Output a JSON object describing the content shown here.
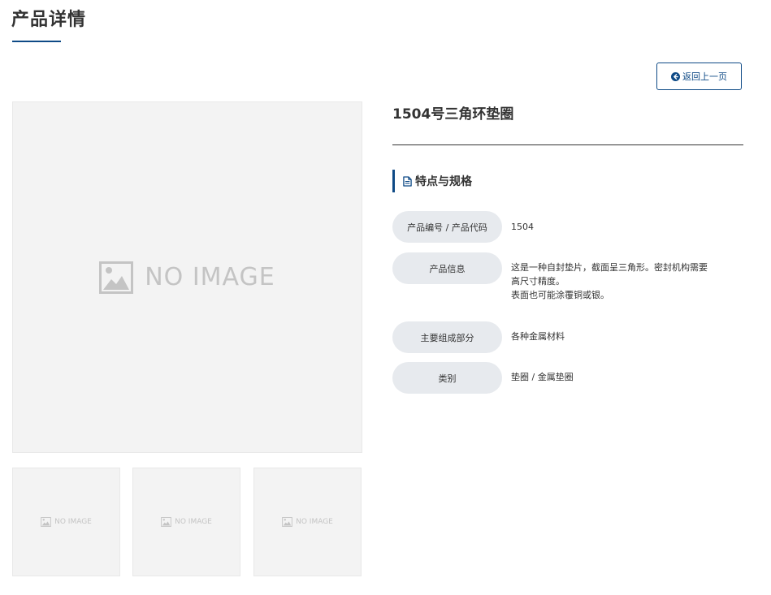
{
  "page": {
    "title": "产品详情"
  },
  "nav": {
    "back_label": "返回上一页",
    "back_icon": "arrow-left-circle-icon"
  },
  "gallery": {
    "main_image_text": "NO IMAGE",
    "thumbnails": [
      {
        "text": "NO IMAGE"
      },
      {
        "text": "NO IMAGE"
      },
      {
        "text": "NO IMAGE"
      }
    ]
  },
  "product": {
    "name": "1504号三角环垫圈",
    "section_title": "特点与规格",
    "section_icon": "document-icon",
    "specs": [
      {
        "label": "产品编号 / 产品代码",
        "value": [
          "1504"
        ]
      },
      {
        "label": "产品信息",
        "value": [
          "这是一种自封垫片，截面呈三角形。密封机构需要",
          "高尺寸精度。",
          "表面也可能涂覆铜或银。"
        ]
      },
      {
        "label": "主要组成部分",
        "value": [
          "各种金属材料"
        ]
      },
      {
        "label": "类别",
        "value": [
          "垫圈 / 金属垫圈"
        ]
      }
    ]
  },
  "colors": {
    "accent": "#0e4a86",
    "label_bg": "#e7eaee",
    "placeholder_bg": "#f3f3f3"
  }
}
